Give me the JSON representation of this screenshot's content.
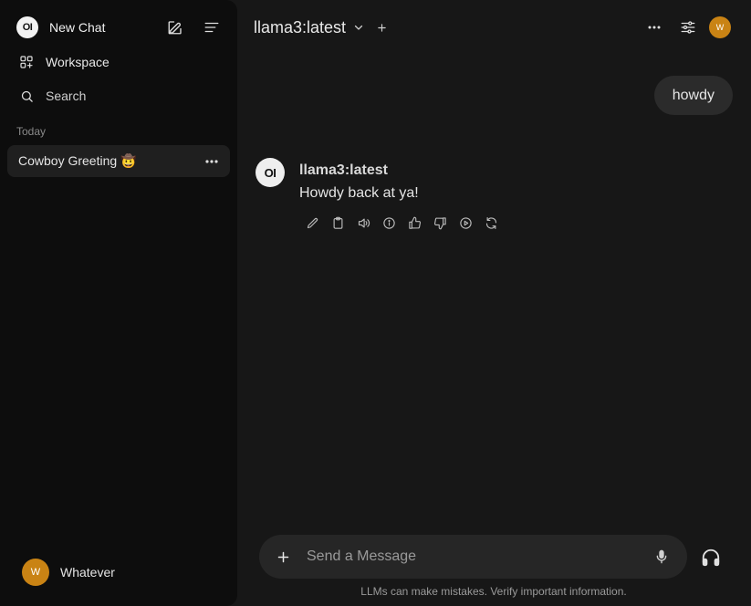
{
  "sidebar": {
    "logo_text": "OI",
    "new_chat_label": "New Chat",
    "workspace_label": "Workspace",
    "search_label": "Search",
    "section_today": "Today",
    "chats": [
      {
        "title": "Cowboy Greeting 🤠"
      }
    ],
    "user": {
      "initial": "W",
      "name": "Whatever"
    }
  },
  "header": {
    "model_name": "llama3:latest",
    "avatar_initial": "W"
  },
  "messages": {
    "user_text": "howdy",
    "assistant_avatar": "OI",
    "assistant_name": "llama3:latest",
    "assistant_text": "Howdy back at ya!"
  },
  "composer": {
    "placeholder": "Send a Message"
  },
  "footer": {
    "disclaimer": "LLMs can make mistakes. Verify important information."
  },
  "colors": {
    "sidebar_bg": "#0d0d0d",
    "main_bg": "#171717",
    "avatar_accent": "#c98314"
  }
}
